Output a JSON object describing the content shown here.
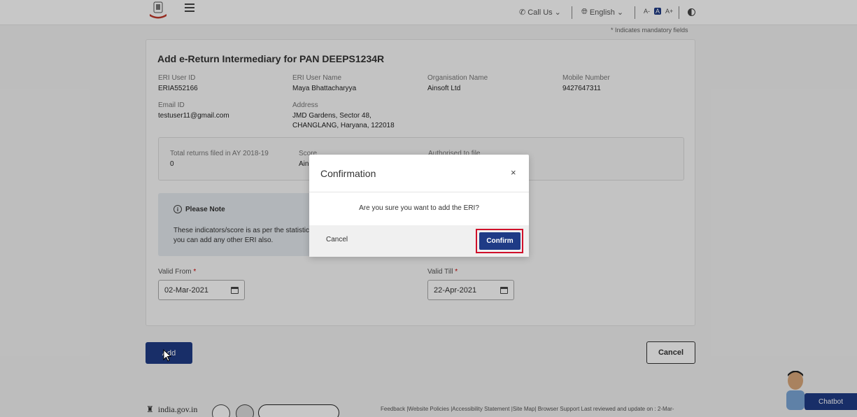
{
  "header": {
    "call_us": "Call Us",
    "language": "English",
    "font_small": "A-",
    "font_normal": "A",
    "font_large": "A+"
  },
  "mandatory_note": "* Indicates mandatory fields",
  "card": {
    "title": "Add e-Return Intermediary for PAN DEEPS1234R",
    "fields": {
      "eri_user_id": {
        "label": "ERI User ID",
        "value": "ERIA552166"
      },
      "eri_user_name": {
        "label": "ERI User Name",
        "value": "Maya Bhattacharyya"
      },
      "org_name": {
        "label": "Organisation Name",
        "value": "Ainsoft Ltd"
      },
      "mobile": {
        "label": "Mobile Number",
        "value": "9427647311"
      },
      "email": {
        "label": "Email ID",
        "value": "testuser11@gmail.com"
      },
      "address": {
        "label": "Address",
        "line1": "JMD Gardens, Sector 48,",
        "line2": "CHANGLANG, Haryana, 122018"
      }
    },
    "stats": {
      "returns_label": "Total returns filed in AY 2018-19",
      "returns_value": "0",
      "score_label": "Score",
      "score_value": "Ain",
      "authorised_label": "Authorised to file"
    },
    "note": {
      "heading": "Please Note",
      "line1": "These indicators/score is as per the statistics",
      "line2": "you can add any other ERI also."
    },
    "valid_from": {
      "label": "Valid From",
      "value": "02-Mar-2021"
    },
    "valid_till": {
      "label": "Valid Till",
      "value": "22-Apr-2021"
    }
  },
  "buttons": {
    "add": "Add",
    "cancel": "Cancel"
  },
  "footer": {
    "logo_text": "india.gov.in",
    "links": "Feedback |Website Policies |Accessibility Statement |Site Map| Browser Support   Last reviewed and update on : 2-Mar-"
  },
  "chatbot": {
    "label": "Chatbot"
  },
  "modal": {
    "title": "Confirmation",
    "close": "×",
    "message": "Are you sure you want to add the ERI?",
    "cancel": "Cancel",
    "confirm": "Confirm"
  },
  "colors": {
    "primary": "#1f3b86",
    "highlight": "#d0102a"
  }
}
